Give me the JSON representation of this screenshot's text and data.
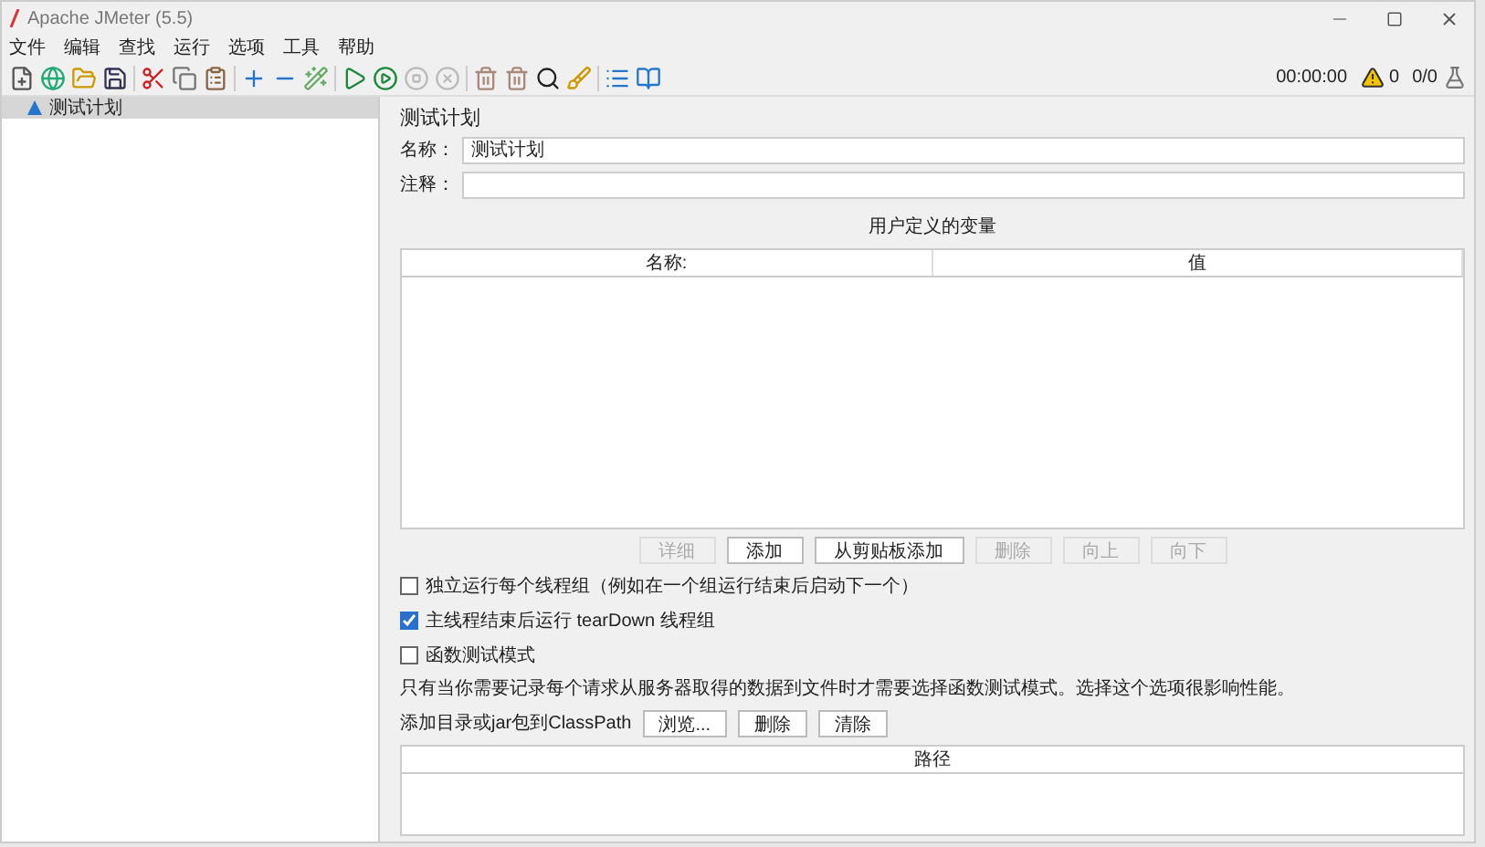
{
  "window": {
    "title": "Apache JMeter (5.5)"
  },
  "menu": [
    "文件",
    "编辑",
    "查找",
    "运行",
    "选项",
    "工具",
    "帮助"
  ],
  "status": {
    "time": "00:00:00",
    "warnings": "0",
    "threads": "0/0"
  },
  "tree": [
    {
      "label": "测试计划",
      "selected": true
    }
  ],
  "panel": {
    "title": "测试计划",
    "fields": [
      {
        "label": "名称：",
        "value": "测试计划"
      },
      {
        "label": "注释："
      }
    ],
    "variables": {
      "title": "用户定义的变量",
      "columns": [
        "名称:",
        "值"
      ]
    },
    "buttons": [
      {
        "label": "详细",
        "disabled": true
      },
      {
        "label": "添加",
        "disabled": false
      },
      {
        "label": "从剪贴板添加",
        "disabled": false
      },
      {
        "label": "删除",
        "disabled": true
      },
      {
        "label": "向上",
        "disabled": true
      },
      {
        "label": "向下",
        "disabled": true
      }
    ],
    "options": [
      {
        "label": "独立运行每个线程组（例如在一个组运行结束后启动下一个）",
        "checked": false
      },
      {
        "label": "主线程结束后运行 tearDown 线程组",
        "checked": true
      },
      {
        "label": "函数测试模式",
        "checked": false
      }
    ],
    "note": "只有当你需要记录每个请求从服务器取得的数据到文件时才需要选择函数测试模式。选择这个选项很影响性能。",
    "classpath": {
      "label": "添加目录或jar包到ClassPath",
      "buttons": [
        "浏览...",
        "删除",
        "清除"
      ],
      "column": "路径"
    }
  }
}
